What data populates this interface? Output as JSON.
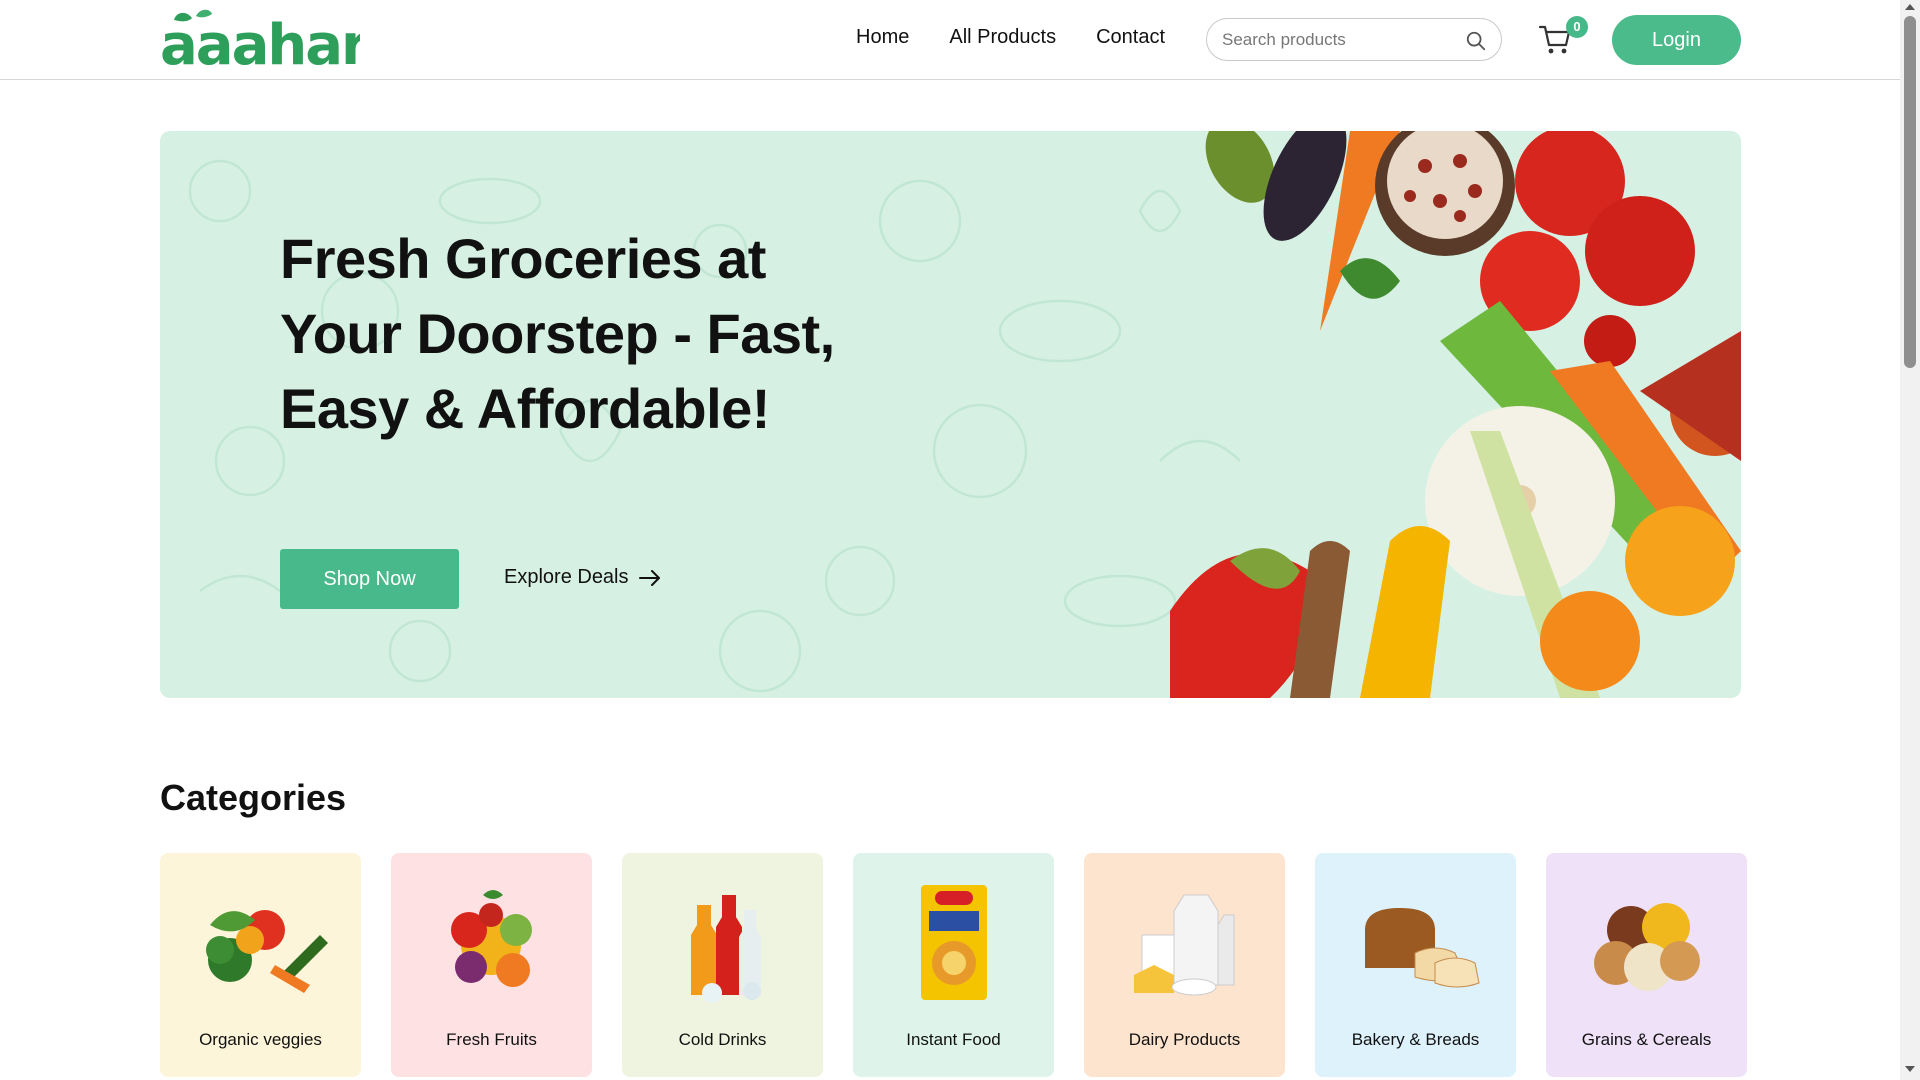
{
  "brand": {
    "logo_text": "aaahar",
    "logo_color": "#2e9e5b"
  },
  "nav": {
    "home": "Home",
    "all_products": "All Products",
    "contact": "Contact"
  },
  "search": {
    "placeholder": "Search products"
  },
  "cart": {
    "count": "0"
  },
  "login": {
    "label": "Login"
  },
  "hero": {
    "title": "Fresh Groceries at Your Doorstep - Fast, Easy & Affordable!",
    "shop_now": "Shop Now",
    "explore_deals": "Explore Deals"
  },
  "categories": {
    "heading": "Categories",
    "items": [
      {
        "label": "Organic veggies",
        "bg": "#fdf5d9",
        "icon": "vegetables-icon"
      },
      {
        "label": "Fresh Fruits",
        "bg": "#fde1e3",
        "icon": "fruits-icon"
      },
      {
        "label": "Cold Drinks",
        "bg": "#eef4df",
        "icon": "cold-drinks-icon"
      },
      {
        "label": "Instant Food",
        "bg": "#def4eb",
        "icon": "instant-noodles-icon"
      },
      {
        "label": "Dairy Products",
        "bg": "#fde4cf",
        "icon": "dairy-icon"
      },
      {
        "label": "Bakery & Breads",
        "bg": "#def2fb",
        "icon": "bread-icon"
      },
      {
        "label": "Grains & Cereals",
        "bg": "#eee1f8",
        "icon": "grains-icon"
      }
    ]
  },
  "colors": {
    "accent": "#4bbb8b",
    "hero_bg": "#d6f1e4"
  }
}
